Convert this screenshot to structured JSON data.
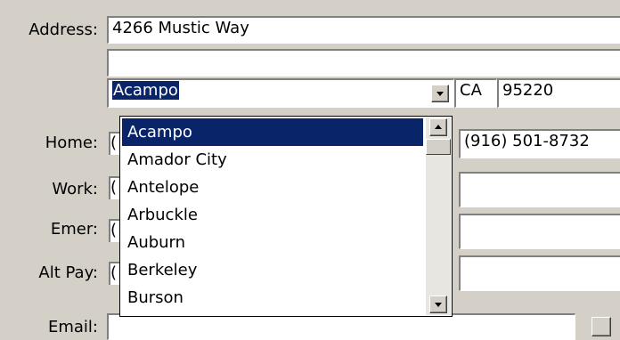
{
  "labels": {
    "address": "Address:",
    "home": "Home:",
    "work": "Work:",
    "emer": "Emer:",
    "alt_pay": "Alt Pay:",
    "email": "Email:"
  },
  "address": {
    "line1": "4266 Mustic Way",
    "line2": "",
    "city": "Acampo",
    "state": "CA",
    "zip": "95220"
  },
  "phones": {
    "home_right": "(916) 501-8732",
    "stub_char": "("
  },
  "city_dropdown": {
    "selected": "Acampo",
    "options": [
      "Acampo",
      "Amador City",
      "Antelope",
      "Arbuckle",
      "Auburn",
      "Berkeley",
      "Burson"
    ]
  },
  "colors": {
    "window_bg": "#d4d0c8",
    "selection_bg": "#0a246a",
    "selection_fg": "#ffffff"
  },
  "icons": {
    "dropdown_arrow": "chevron-down-icon",
    "scroll_up": "scroll-up-icon",
    "scroll_down": "scroll-down-icon"
  }
}
